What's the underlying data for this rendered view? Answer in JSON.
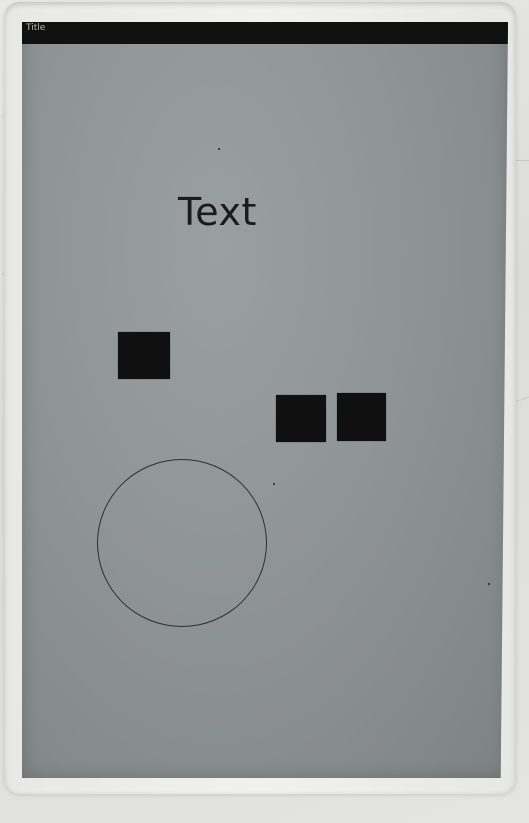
{
  "window": {
    "title": "Title"
  },
  "screen": {
    "label_text": "Text",
    "squares": 3,
    "circle": 1
  }
}
